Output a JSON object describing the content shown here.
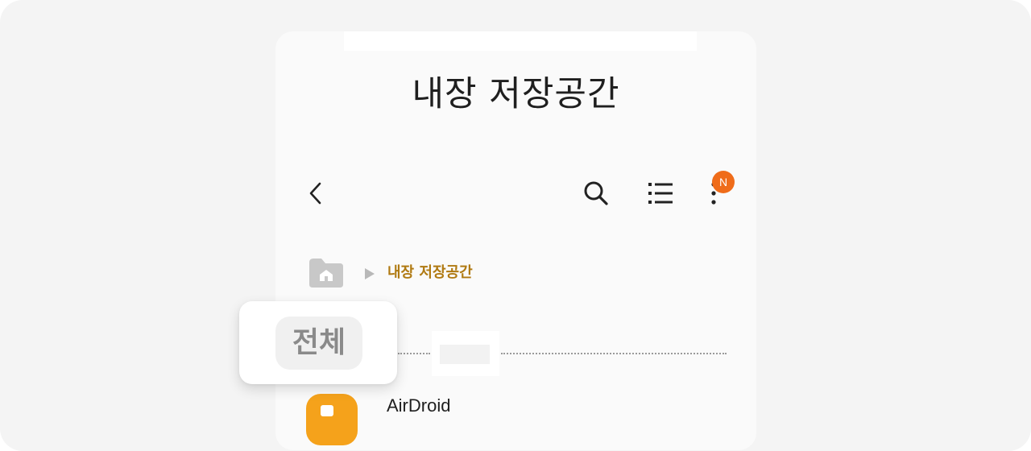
{
  "screen": {
    "title": "내장 저장공간"
  },
  "toolbar": {
    "back_icon": "chevron-left-icon",
    "search_icon": "search-icon",
    "list_view_icon": "list-view-icon",
    "more_icon": "more-vertical-icon",
    "notification_badge": "N",
    "badge_color": "#ef6c1a"
  },
  "breadcrumb": {
    "home_icon": "home-folder-icon",
    "separator_icon": "play-arrow-icon",
    "current": "내장 저장공간",
    "current_color": "#b07a12"
  },
  "filter": {
    "label": "전체"
  },
  "files": [
    {
      "name": "AirDroid",
      "icon": "folder-icon",
      "icon_color": "#f5a21b"
    }
  ]
}
